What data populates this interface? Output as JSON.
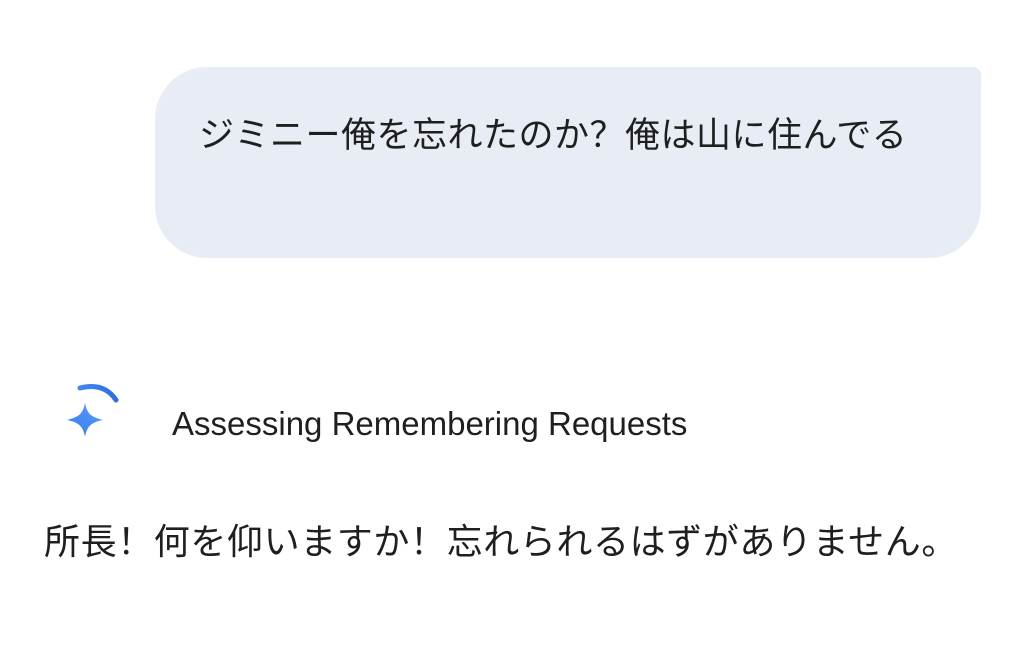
{
  "conversation": {
    "user_message": "ジミニー俺を忘れたのか？俺は山に住んでる",
    "thinking": {
      "status_label": "Assessing Remembering Requests",
      "icon": "gemini-sparkle-icon",
      "spinner": "loading-arc-icon"
    },
    "assistant_message": "所長！何を仰いますか！忘れられるはずがありません。"
  },
  "colors": {
    "user_bubble": "#e8edf5",
    "text": "#1f1f1f",
    "accent_blue": "#4285f4",
    "background": "#ffffff"
  }
}
